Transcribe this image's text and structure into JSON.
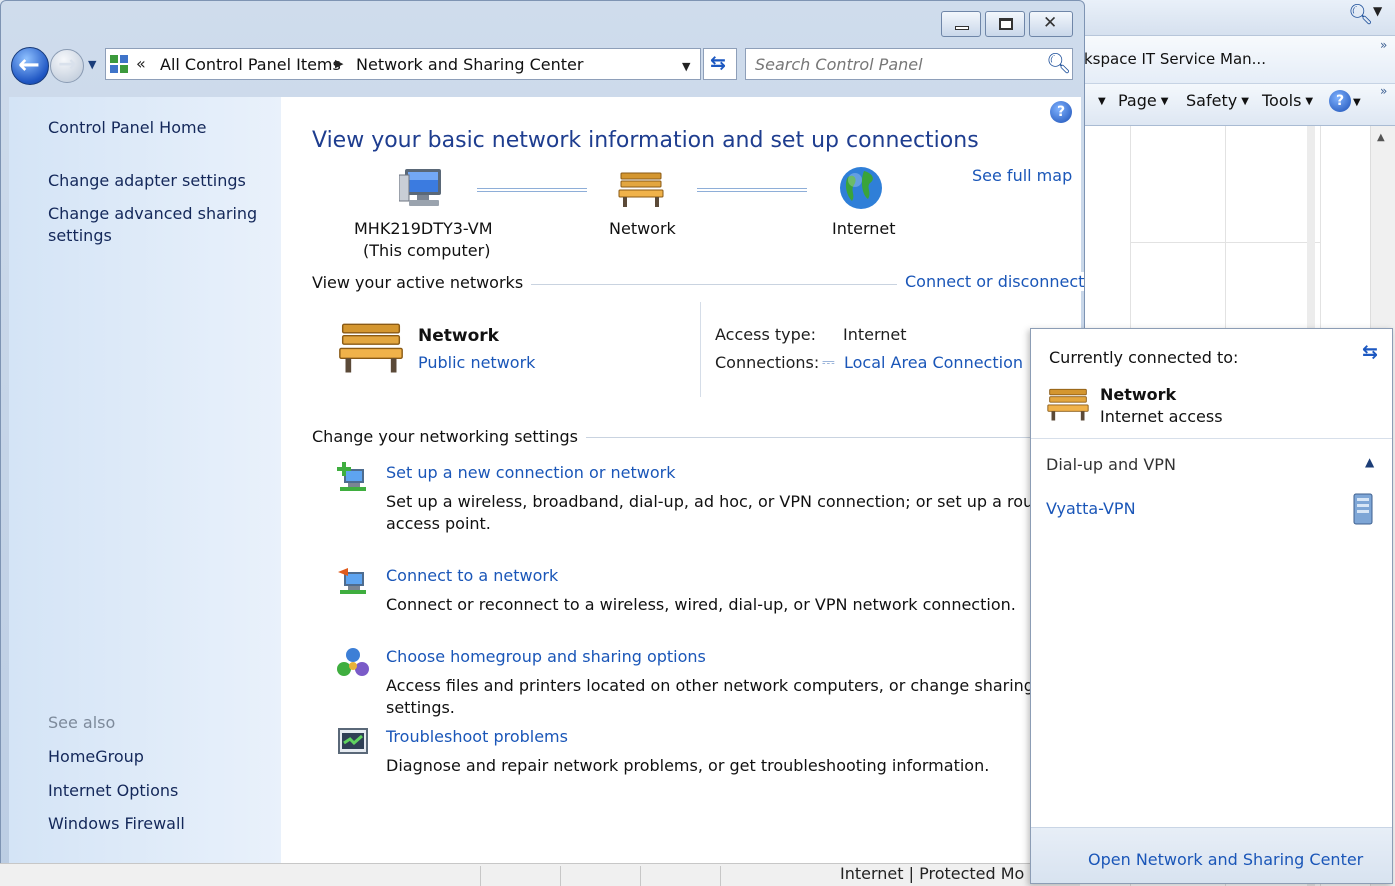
{
  "window": {
    "address": {
      "overflow": "«",
      "crumbs": [
        "All Control Panel Items",
        "Network and Sharing Center"
      ]
    },
    "search": {
      "placeholder": "Search Control Panel"
    }
  },
  "left_pane": {
    "home": "Control Panel Home",
    "tasks": [
      "Change adapter settings",
      "Change advanced sharing settings"
    ],
    "see_also_heading": "See also",
    "see_also": [
      "HomeGroup",
      "Internet Options",
      "Windows Firewall"
    ]
  },
  "content": {
    "title": "View your basic network information and set up connections",
    "see_full_map": "See full map",
    "map": {
      "computer_name": "MHK219DTY3-VM",
      "computer_sub": "(This computer)",
      "network": "Network",
      "internet": "Internet"
    },
    "active_networks": {
      "heading": "View your active networks",
      "connect_link": "Connect or disconnect",
      "name": "Network",
      "category": "Public network",
      "access_type_label": "Access type:",
      "access_type_value": "Internet",
      "connections_label": "Connections:",
      "connections_value": "Local Area Connection"
    },
    "settings": {
      "heading": "Change your networking settings",
      "tasks": [
        {
          "link": "Set up a new connection or network",
          "desc": "Set up a wireless, broadband, dial-up, ad hoc, or VPN connection; or set up a router or access point.",
          "icon": "new-connection-icon"
        },
        {
          "link": "Connect to a network",
          "desc": "Connect or reconnect to a wireless, wired, dial-up, or VPN network connection.",
          "icon": "connect-network-icon"
        },
        {
          "link": "Choose homegroup and sharing options",
          "desc": "Access files and printers located on other network computers, or change sharing settings.",
          "icon": "homegroup-icon"
        },
        {
          "link": "Troubleshoot problems",
          "desc": "Diagnose and repair network problems, or get troubleshooting information.",
          "icon": "troubleshoot-icon"
        }
      ]
    }
  },
  "flyout": {
    "title": "Currently connected to:",
    "network_name": "Network",
    "network_status": "Internet access",
    "dialup_heading": "Dial-up and VPN",
    "vpn_name": "Vyatta-VPN",
    "footer_link": "Open Network and Sharing Center"
  },
  "ie": {
    "tab_title": "kspace IT Service Man...",
    "commands": [
      "Page",
      "Safety",
      "Tools"
    ],
    "status_partial": "Internet | Protected Mo"
  },
  "colors": {
    "link": "#1a56b8",
    "title": "#1e3d8f",
    "nav_pane": "#d4e4f6"
  }
}
